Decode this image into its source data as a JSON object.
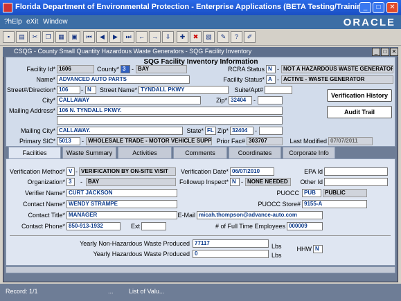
{
  "window": {
    "title": "Florida Department of Environmental Protection - Enterprise Applications (BETA Testing/Training)",
    "min": "_",
    "max": "□",
    "close": "✕"
  },
  "menu": [
    "?hElp",
    "eXit",
    "Window"
  ],
  "brand": "ORACLE",
  "frame_title": "CSQG - County Small Quantity Hazardous Waste Generators - SQG Facility Inventory",
  "section_title": "SQG Facility Inventory Information",
  "header": {
    "facility_id_label": "Facility Id*",
    "facility_id": "1606",
    "county_label": "County*",
    "county_code": "3",
    "county_name": "BAY",
    "rcra_status_label": "RCRA Status",
    "rcra_status_code": "N",
    "rcra_status_desc": "NOT A HAZARDOUS WASTE GENERATOR",
    "name_label": "Name*",
    "name": "ADVANCED AUTO PARTS",
    "facility_status_label": "Facility Status*",
    "facility_status_code": "A",
    "facility_status_desc": "ACTIVE - WASTE GENERATOR",
    "street_label": "Street#/Direction*",
    "street_number": "106",
    "direction": "N",
    "street_name_label": "Street Name*",
    "street_name": "TYNDALL PKWY",
    "suite_label": "Suite/Apt#",
    "suite": "",
    "city_label": "City*",
    "city": "CALLAWAY",
    "zip_label": "Zip*",
    "zip": "32404",
    "zip_ext": "",
    "mailing_address_label": "Mailing Address*",
    "mailing_address_1": "106 N. TYNDALL PKWY.",
    "mailing_address_2": "",
    "mailing_city_label": "Mailing City*",
    "mailing_city": "CALLAWAY.",
    "state_label": "State*",
    "state": "FL",
    "mailing_zip_label": "Zip*",
    "mailing_zip": "32404",
    "mailing_zip_ext": "",
    "primary_sic_label": "Primary SIC*",
    "primary_sic_code": "5013",
    "primary_sic_desc": "WHOLESALE TRADE - MOTOR VEHICLE SUPPLIE",
    "prior_fac_label": "Prior Fac#",
    "prior_fac": "303707",
    "last_modified_label": "Last Modified",
    "last_modified": "07/07/2011",
    "verification_history_btn": "Verification History",
    "audit_trail_btn": "Audit Trail"
  },
  "tabs": [
    "Facilities",
    "Waste Summary",
    "Activities",
    "Comments",
    "Coordinates",
    "Corporate Info"
  ],
  "facilities": {
    "verification_method_label": "Verification Method*",
    "verification_method_code": "V",
    "verification_method_desc": "VERIFICATION BY ON-SITE VISIT",
    "verification_date_label": "Verification Date*",
    "verification_date": "06/07/2010",
    "epa_id_label": "EPA Id",
    "epa_id": "",
    "organization_label": "Organization*",
    "organization_code": "3",
    "organization_name": "BAY",
    "followup_label": "Followup Inspect*",
    "followup_code": "N",
    "followup_desc": "NONE NEEDED",
    "other_id_label": "Other Id",
    "other_id": "",
    "verifier_label": "Verifier Name*",
    "verifier": "CURT JACKSON",
    "puocc_label": "PUOCC",
    "puocc_code": "PUB",
    "puocc_desc": "PUBLIC",
    "contact_name_label": "Contact Name*",
    "contact_name": "WENDY STRAMPE",
    "puocc_store_label": "PUOCC Store#",
    "puocc_store": "9155-A",
    "contact_title_label": "Contact Title*",
    "contact_title": "MANAGER",
    "email_label": "E-Mail",
    "email": "micah.thompson@advance-auto.com",
    "contact_phone_label": "Contact Phone*",
    "contact_phone": "850-913-1932",
    "ext_label": "Ext",
    "ext": "",
    "employees_label": "# of Full Time Employees",
    "employees": "000009",
    "nonhaz_label": "Yearly Non-Hazardous Waste Produced",
    "nonhaz": "77117",
    "haz_label": "Yearly Hazardous Waste Produced",
    "haz": "0",
    "lbs1": "Lbs",
    "lbs2": "Lbs",
    "hhw_label": "HHW",
    "hhw": "N"
  },
  "status": {
    "record": "Record: 1/1",
    "dots": "...",
    "list": "List of Valu..."
  }
}
